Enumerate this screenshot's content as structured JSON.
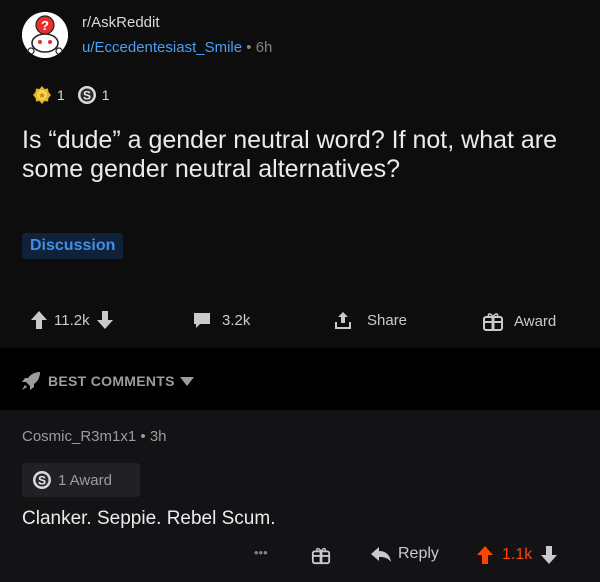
{
  "post": {
    "subreddit": "r/AskReddit",
    "author": "u/Eccedentesiast_Smile",
    "separator": "•",
    "age": "6h",
    "awards": [
      {
        "icon": "gold-award-icon",
        "count": "1"
      },
      {
        "icon": "silver-award-icon",
        "count": "1"
      }
    ],
    "title": "Is “dude” a gender neutral word? If not, what are some gender neutral alternatives?",
    "flair": "Discussion",
    "votes": "11.2k",
    "comments": "3.2k",
    "share_label": "Share",
    "award_label": "Award"
  },
  "sort": {
    "label": "BEST COMMENTS"
  },
  "comment": {
    "author": "Cosmic_R3m1x1",
    "separator": "•",
    "age": "3h",
    "award_label": "1 Award",
    "body": "Clanker. Seppie. Rebel Scum.",
    "more": "•••",
    "reply_label": "Reply",
    "votes": "1.1k"
  },
  "colors": {
    "accent_blue": "#4a9ff5",
    "upvote_orange": "#ff4500",
    "background": "#0d0d0e"
  }
}
